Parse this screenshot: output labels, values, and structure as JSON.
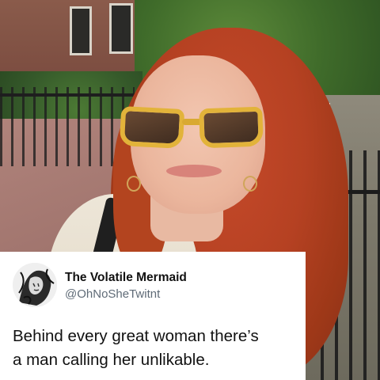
{
  "tweet": {
    "display_name": "The Volatile Mermaid",
    "handle": "@OhNoSheTwitnt",
    "text_lines": [
      "Behind every great woman there’s",
      "a man calling her unlikable."
    ],
    "avatar_icon": "sketch-portrait-avatar-icon"
  },
  "photo": {
    "subject": "red-haired woman in yellow tortoiseshell sunglasses"
  },
  "colors": {
    "card_background": "#ffffff",
    "name_color": "#111111",
    "handle_color": "#5f6b77",
    "hair_accent": "#b54122",
    "sunglasses_frame": "#e2b33a"
  }
}
